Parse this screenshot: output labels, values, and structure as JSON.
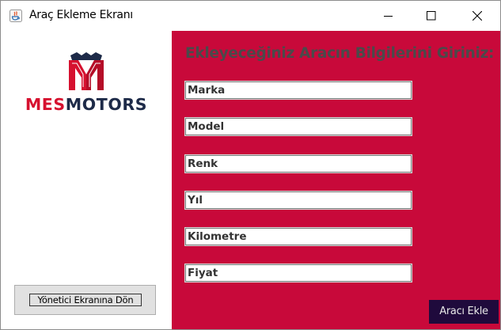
{
  "window": {
    "title": "Araç Ekleme Ekranı",
    "icon": "java-icon",
    "controls": [
      "minimize-icon",
      "maximize-icon",
      "close-icon"
    ]
  },
  "logo": {
    "brand_left": "MES",
    "brand_right": "MOTORS",
    "colors": {
      "red": "#d6112f",
      "navy": "#1d2a48"
    }
  },
  "left_panel": {
    "back_button_label": "Yönetici Ekranına Dön"
  },
  "form": {
    "heading": "Ekleyeceğiniz Aracın Bilgilerini Giriniz:",
    "fields": [
      {
        "value": "Marka"
      },
      {
        "value": "Model"
      },
      {
        "value": "Renk"
      },
      {
        "value": "Yıl"
      },
      {
        "value": "Kilometre"
      },
      {
        "value": "Fiyat"
      }
    ],
    "submit_label": "Aracı Ekle",
    "background_color": "#c8093a",
    "submit_color": "#1f0a3c"
  }
}
